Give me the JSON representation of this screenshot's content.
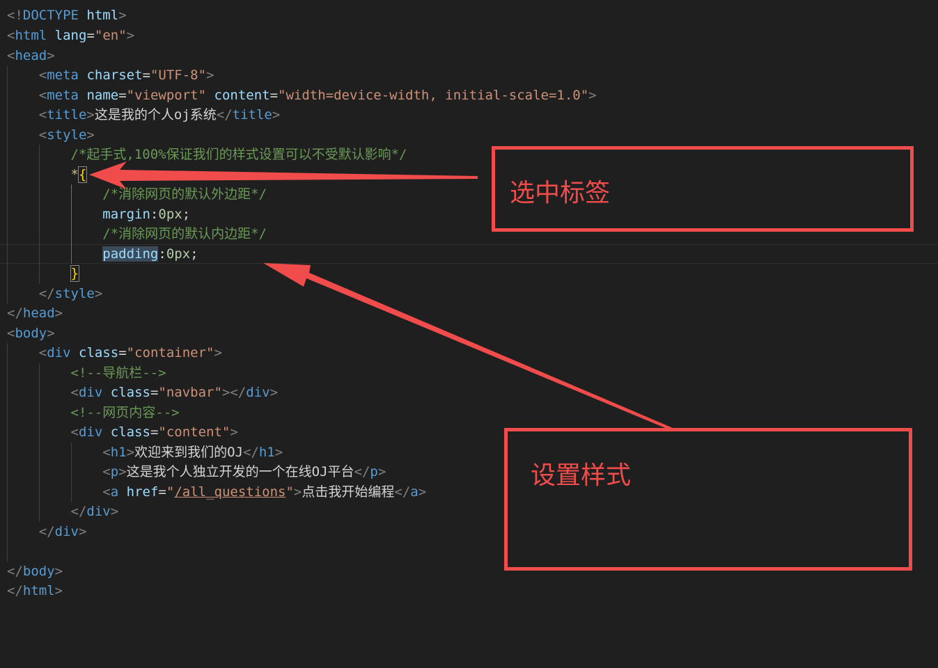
{
  "code": {
    "l1": {
      "a": "<!",
      "b": "DOCTYPE",
      "c": "html",
      "d": ">"
    },
    "l2": {
      "a": "<",
      "b": "html",
      "c": "lang",
      "d": "=",
      "e": "\"en\"",
      "f": ">"
    },
    "l3": {
      "a": "<",
      "b": "head",
      "c": ">"
    },
    "l4": {
      "a": "<",
      "b": "meta",
      "c": "charset",
      "d": "=",
      "e": "\"UTF-8\"",
      "f": ">"
    },
    "l5": {
      "a": "<",
      "b": "meta",
      "c": "name",
      "d": "=",
      "e": "\"viewport\"",
      "f": "content",
      "g": "=",
      "h": "\"width=device-width, initial-scale=1.0\"",
      "i": ">"
    },
    "l6": {
      "a": "<",
      "b": "title",
      "c": ">",
      "d": "这是我的个人oj系统",
      "e": "</",
      "f": "title",
      "g": ">"
    },
    "l7": {
      "a": "<",
      "b": "style",
      "c": ">"
    },
    "l8": {
      "a": "/*起手式,100%保证我们的样式设置可以不受默认影响*/"
    },
    "l9": {
      "a": "*",
      "b": "{"
    },
    "l10": {
      "a": "/*消除网页的默认外边距*/"
    },
    "l11": {
      "a": "margin",
      "b": ":",
      "c": "0px",
      "d": ";"
    },
    "l12": {
      "a": "/*消除网页的默认内边距*/"
    },
    "l13": {
      "a": "padding",
      "b": ":",
      "c": "0px",
      "d": ";"
    },
    "l14": {
      "a": "}"
    },
    "l15": {
      "a": "</",
      "b": "style",
      "c": ">"
    },
    "l16": {
      "a": "</",
      "b": "head",
      "c": ">"
    },
    "l17": {
      "a": "<",
      "b": "body",
      "c": ">"
    },
    "l18": {
      "a": "<",
      "b": "div",
      "c": "class",
      "d": "=",
      "e": "\"container\"",
      "f": ">"
    },
    "l19": {
      "a": "<!--导航栏-->"
    },
    "l20": {
      "a": "<",
      "b": "div",
      "c": "class",
      "d": "=",
      "e": "\"navbar\"",
      "f": "></",
      "g": "div",
      "h": ">"
    },
    "l21": {
      "a": "<!--网页内容-->"
    },
    "l22": {
      "a": "<",
      "b": "div",
      "c": "class",
      "d": "=",
      "e": "\"content\"",
      "f": ">"
    },
    "l23": {
      "a": "<",
      "b": "h1",
      "c": ">",
      "d": "欢迎来到我们的OJ",
      "e": "</",
      "f": "h1",
      "g": ">"
    },
    "l24": {
      "a": "<",
      "b": "p",
      "c": ">",
      "d": "这是我个人独立开发的一个在线OJ平台",
      "e": "</",
      "f": "p",
      "g": ">"
    },
    "l25": {
      "a": "<",
      "b": "a",
      "c": "href",
      "d": "=",
      "e": "\"",
      "f": "/all_questions",
      "g": "\"",
      "h": ">",
      "i": "点击我开始编程",
      "j": "</",
      "k": "a",
      "l": ">"
    },
    "l26": {
      "a": "</",
      "b": "div",
      "c": ">"
    },
    "l27": {
      "a": "</",
      "b": "div",
      "c": ">"
    },
    "l29": {
      "a": "</",
      "b": "body",
      "c": ">"
    },
    "l30": {
      "a": "</",
      "b": "html",
      "c": ">"
    }
  },
  "annotations": {
    "select_tag": "选中标签",
    "set_style": "设置样式",
    "color": "#f14c4c"
  }
}
